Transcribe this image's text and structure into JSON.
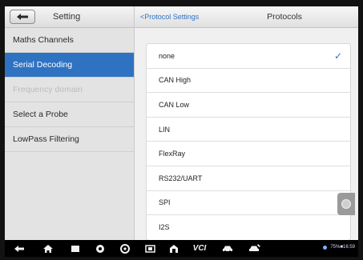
{
  "left_panel": {
    "title": "Setting",
    "items": [
      {
        "label": "Maths Channels",
        "state": "normal"
      },
      {
        "label": "Serial Decoding",
        "state": "active"
      },
      {
        "label": "Frequency domain",
        "state": "disabled"
      },
      {
        "label": "Select a Probe",
        "state": "normal"
      },
      {
        "label": "LowPass Filtering",
        "state": "normal"
      }
    ]
  },
  "right_panel": {
    "breadcrumb": "<Protocol Settings",
    "title": "Protocols",
    "options": [
      {
        "label": "none",
        "selected": true
      },
      {
        "label": "CAN High",
        "selected": false
      },
      {
        "label": "CAN Low",
        "selected": false
      },
      {
        "label": "LIN",
        "selected": false
      },
      {
        "label": "FlexRay",
        "selected": false
      },
      {
        "label": "RS232/UART",
        "selected": false
      },
      {
        "label": "SPI",
        "selected": false
      },
      {
        "label": "I2S",
        "selected": false
      }
    ]
  },
  "navbar": {
    "icons": [
      "back-arrow-icon",
      "home-icon",
      "recent-apps-icon",
      "settings-icon",
      "camera-icon",
      "gallery-icon",
      "garage-icon",
      "vci-icon",
      "car-icon",
      "repair-icon"
    ],
    "vci_label": "VCI",
    "status_text": "75%■16:59"
  },
  "colors": {
    "accent": "#2f72c2",
    "active_bg": "#2f72c2",
    "disabled_text": "#bcbcbc"
  }
}
